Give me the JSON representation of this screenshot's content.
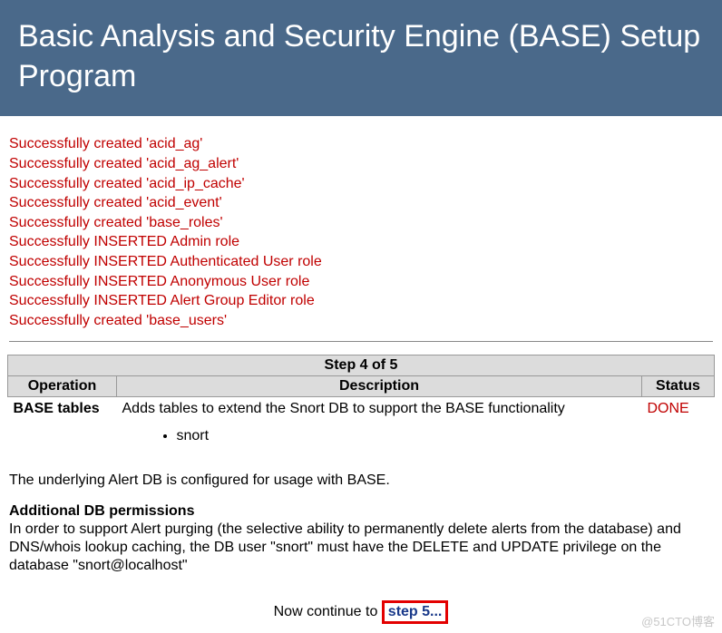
{
  "header": {
    "title": "Basic Analysis and Security Engine (BASE) Setup Program"
  },
  "messages": [
    "Successfully created 'acid_ag'",
    "Successfully created 'acid_ag_alert'",
    "Successfully created 'acid_ip_cache'",
    "Successfully created 'acid_event'",
    "Successfully created 'base_roles'",
    "Successfully INSERTED Admin role",
    "Successfully INSERTED Authenticated User role",
    "Successfully INSERTED Anonymous User role",
    "Successfully INSERTED Alert Group Editor role",
    "Successfully created 'base_users'"
  ],
  "step_table": {
    "caption": "Step 4 of 5",
    "columns": {
      "op": "Operation",
      "desc": "Description",
      "status": "Status"
    },
    "rows": [
      {
        "operation": "BASE tables",
        "description": "Adds tables to extend the Snort DB to support the BASE functionality",
        "status": "DONE",
        "items": [
          "snort"
        ]
      }
    ]
  },
  "body": {
    "config_text": "The underlying Alert DB is configured for usage with BASE.",
    "perm_head": "Additional DB permissions",
    "perm_text": "In order to support Alert purging (the selective ability to permanently delete alerts from the database) and DNS/whois lookup caching, the DB user \"snort\" must have the DELETE and UPDATE privilege on the database \"snort@localhost\""
  },
  "continue": {
    "prefix": "Now continue to ",
    "link_text": "step 5..."
  },
  "watermark": "@51CTO博客"
}
